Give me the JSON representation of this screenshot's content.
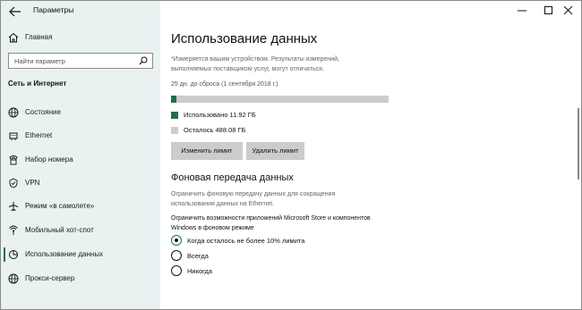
{
  "window": {
    "title": "Параметры"
  },
  "sidebar": {
    "home_label": "Главная",
    "search_placeholder": "Найти параметр",
    "section_title": "Сеть и Интернет",
    "items": [
      {
        "label": "Состояние",
        "icon": "globe-icon"
      },
      {
        "label": "Ethernet",
        "icon": "ethernet-icon"
      },
      {
        "label": "Набор номера",
        "icon": "dialup-icon"
      },
      {
        "label": "VPN",
        "icon": "vpn-icon"
      },
      {
        "label": "Режим «в самолете»",
        "icon": "airplane-icon"
      },
      {
        "label": "Мобильный хот-спот",
        "icon": "hotspot-icon"
      },
      {
        "label": "Использование данных",
        "icon": "data-usage-icon",
        "active": true
      },
      {
        "label": "Прокси-сервер",
        "icon": "globe-icon"
      }
    ]
  },
  "main": {
    "title": "Использование данных",
    "note": "*Измеряется вашим устройством. Результаты измерений, выполняемых поставщиком услуг, могут отличаться.",
    "reset_text": "25 дн. до сброса (1 сентября 2018 г.)",
    "usage": {
      "used_fraction": 0.024,
      "used_color": "#1e7145",
      "remaining_color": "#cccccc"
    },
    "used_label": "Использовано 11.92 ГБ",
    "remaining_label": "Осталось 488.08 ГБ",
    "edit_limit_button": "Изменить лимит",
    "remove_limit_button": "Удалить лимит",
    "background_title": "Фоновая передача данных",
    "background_desc": "Ограничить фоновую передачу данных для сокращения использования данных на Ethernet.",
    "store_label": "Ограничить возможности приложений Microsoft Store и компонентов Windows в фоновом режиме",
    "options": [
      {
        "label": "Когда осталось не более 10% лимита",
        "selected": true
      },
      {
        "label": "Всегда",
        "selected": false
      },
      {
        "label": "Никогда",
        "selected": false
      }
    ]
  }
}
